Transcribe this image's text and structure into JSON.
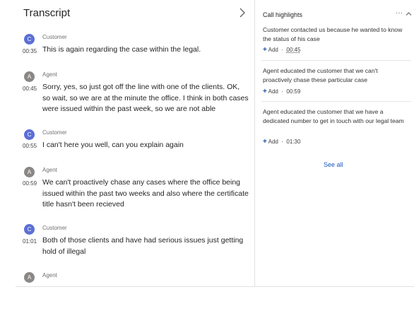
{
  "transcript": {
    "title": "Transcript",
    "messages": [
      {
        "speaker": "Customer",
        "avatar_letter": "C",
        "role": "customer",
        "time": "00:35",
        "text": "This is again regarding the case within the legal."
      },
      {
        "speaker": "Agent",
        "avatar_letter": "A",
        "role": "agent",
        "time": "00:45",
        "text": "Sorry, yes, so just got off the line with one of the clients. OK, so wait, so we are at the minute the office. I think in both cases were issued within the past week, so we are not able"
      },
      {
        "speaker": "Customer",
        "avatar_letter": "C",
        "role": "customer",
        "time": "00:55",
        "text": "I can't here you well, can you explain again"
      },
      {
        "speaker": "Agent",
        "avatar_letter": "A",
        "role": "agent",
        "time": "00:59",
        "text": "We can't proactively chase any cases where the office being issued within the past two weeks and also where the certificate title hasn't been recieved"
      },
      {
        "speaker": "Customer",
        "avatar_letter": "C",
        "role": "customer",
        "time": "01:01",
        "text": "Both of those clients and have had serious issues just getting hold of illegal"
      },
      {
        "speaker": "Agent",
        "avatar_letter": "A",
        "role": "agent",
        "time": "",
        "text": ""
      }
    ]
  },
  "highlights": {
    "title": "Call highlights",
    "more_label": "···",
    "items": [
      {
        "text": "Customer contacted us because he wanted to know the status of his case",
        "add_label": "Add",
        "time": "00:45"
      },
      {
        "text": "Agent educated the customer that we can't proactively chase these particular case",
        "add_label": "Add",
        "time": "00:59"
      },
      {
        "text": "Agent educated the customer that we have a dedicated number to get in touch with our legal team",
        "add_label": "Add",
        "time": "01:30"
      }
    ],
    "see_all": "See all"
  },
  "colors": {
    "accent": "#1a56c4",
    "customer_avatar": "#5b6fd6",
    "agent_avatar": "#8a8886"
  }
}
